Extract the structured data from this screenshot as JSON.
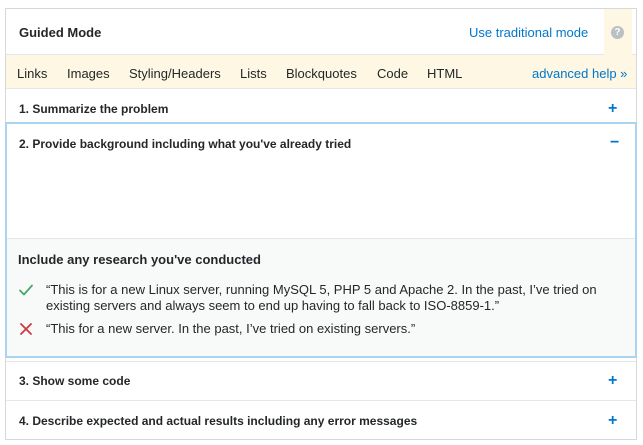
{
  "header": {
    "title": "Guided Mode",
    "traditional_link": "Use traditional mode",
    "help_glyph": "?"
  },
  "tabs": [
    "Links",
    "Images",
    "Styling/Headers",
    "Lists",
    "Blockquotes",
    "Code",
    "HTML"
  ],
  "advanced_help": "advanced help »",
  "sections": [
    {
      "title": "1. Summarize the problem",
      "toggle": "+"
    },
    {
      "title": "2. Provide background including what you've already tried",
      "toggle": "−"
    },
    {
      "title": "3. Show some code",
      "toggle": "+"
    },
    {
      "title": "4. Describe expected and actual results including any error messages",
      "toggle": "+"
    }
  ],
  "tips": {
    "heading": "Include any research you've conducted",
    "good_example": "“This is for a new Linux server, running MySQL 5, PHP 5 and Apache 2. In the past, I’ve tried on existing servers and always seem to end up having to fall back to ISO-8859-1.”",
    "bad_example": "“This for a new server. In the past, I’ve tried on existing servers.”"
  },
  "colors": {
    "link": "#0077cc",
    "good": "#48a868",
    "bad": "#d1383d",
    "active_border": "#a9d4f2",
    "tab_background": "#fdf7e3"
  },
  "icons": {
    "good": "check-icon",
    "bad": "cross-icon",
    "help": "help-icon"
  }
}
